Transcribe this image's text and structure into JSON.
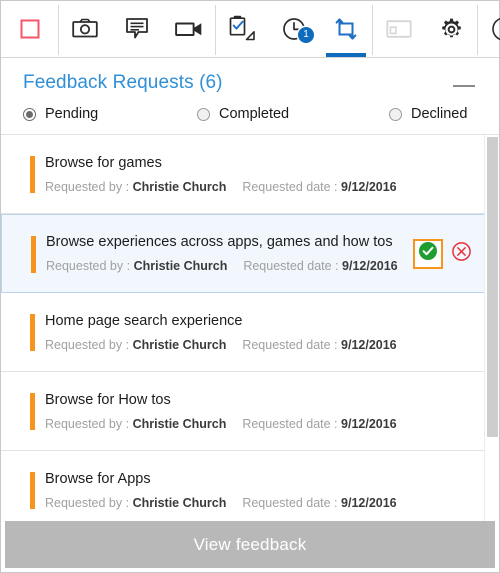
{
  "toolbar": {
    "buttons": [
      {
        "name": "stop-recording-icon",
        "label": "Stop",
        "icon": "stop-square-icon",
        "active": false,
        "badge": null,
        "disabled": false
      },
      {
        "name": "screenshot-icon",
        "label": "Screenshot",
        "icon": "camera-icon",
        "active": false,
        "badge": null,
        "disabled": false
      },
      {
        "name": "comment-icon",
        "label": "Comment",
        "icon": "speech-bubble-icon",
        "active": false,
        "badge": null,
        "disabled": false
      },
      {
        "name": "record-video-icon",
        "label": "Record video",
        "icon": "video-camera-icon",
        "active": false,
        "badge": null,
        "disabled": false
      },
      {
        "name": "tasks-icon",
        "label": "Tasks",
        "icon": "clipboard-check-icon",
        "active": false,
        "badge": null,
        "disabled": false
      },
      {
        "name": "recent-icon",
        "label": "Recent",
        "icon": "clock-icon",
        "active": false,
        "badge": "1",
        "disabled": false
      },
      {
        "name": "feedback-requests-icon",
        "label": "Feedback requests",
        "icon": "feedback-loop-icon",
        "active": true,
        "badge": null,
        "disabled": false
      },
      {
        "name": "screen-capture-icon",
        "label": "Screen",
        "icon": "monitor-icon",
        "active": false,
        "badge": null,
        "disabled": true
      },
      {
        "name": "settings-icon",
        "label": "Settings",
        "icon": "gear-icon",
        "active": false,
        "badge": null,
        "disabled": false
      },
      {
        "name": "info-icon",
        "label": "Info",
        "icon": "info-circle-icon",
        "active": false,
        "badge": null,
        "disabled": false
      }
    ]
  },
  "panel": {
    "title": "Feedback Requests (6)",
    "minimize_label": "Minimize"
  },
  "filters": {
    "options": [
      {
        "label": "Pending",
        "checked": true
      },
      {
        "label": "Completed",
        "checked": false
      },
      {
        "label": "Declined",
        "checked": false
      }
    ]
  },
  "list": {
    "requested_by_label": "Requested by :",
    "requested_date_label": "Requested date :",
    "accept_label": "Accept",
    "decline_label": "Decline",
    "items": [
      {
        "title": "Browse for games",
        "requested_by": "Christie Church",
        "requested_date": "9/12/2016",
        "selected": false,
        "actions_visible": false
      },
      {
        "title": "Browse experiences across apps, games and how tos",
        "requested_by": "Christie Church",
        "requested_date": "9/12/2016",
        "selected": true,
        "actions_visible": true
      },
      {
        "title": "Home page search experience",
        "requested_by": "Christie Church",
        "requested_date": "9/12/2016",
        "selected": false,
        "actions_visible": false
      },
      {
        "title": "Browse for How tos",
        "requested_by": "Christie Church",
        "requested_date": "9/12/2016",
        "selected": false,
        "actions_visible": false
      },
      {
        "title": "Browse for Apps",
        "requested_by": "Christie Church",
        "requested_date": "9/12/2016",
        "selected": false,
        "actions_visible": false
      }
    ]
  },
  "footer": {
    "label": "View feedback"
  },
  "colors": {
    "accent_blue": "#0f6cbd",
    "title_blue": "#2f8fd8",
    "row_accent_orange": "#f7941e",
    "accept_green": "#1f9d2f",
    "decline_red": "#e8323c",
    "selected_row_bg": "#f2f7fd",
    "footer_gray": "#b8b8b8"
  }
}
